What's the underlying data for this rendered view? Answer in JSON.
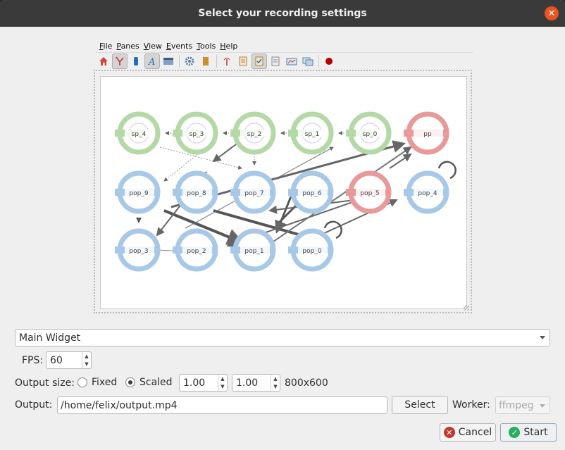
{
  "window": {
    "title": "Select your recording settings",
    "close_glyph": "✕"
  },
  "preview": {
    "menu": [
      "File",
      "Panes",
      "View",
      "Events",
      "Tools",
      "Help"
    ],
    "toolbar_icons": [
      "home-icon",
      "network-graph-icon",
      "device-icon",
      "text-icon",
      "window-icon",
      "settings-gear-icon",
      "clipboard-icon",
      "antenna-icon",
      "report-icon",
      "checked-report-icon",
      "document-icon",
      "chart-window-icon",
      "compare-window-icon",
      "record-icon"
    ],
    "graph": {
      "nodes": [
        {
          "id": "sp_4",
          "color": "green"
        },
        {
          "id": "sp_3",
          "color": "green"
        },
        {
          "id": "sp_2",
          "color": "green"
        },
        {
          "id": "sp_1",
          "color": "green"
        },
        {
          "id": "sp_0",
          "color": "green"
        },
        {
          "id": "pp",
          "color": "red"
        },
        {
          "id": "pop_9",
          "color": "blue"
        },
        {
          "id": "pop_8",
          "color": "blue"
        },
        {
          "id": "pop_7",
          "color": "blue"
        },
        {
          "id": "pop_6",
          "color": "blue"
        },
        {
          "id": "pop_5",
          "color": "red"
        },
        {
          "id": "pop_4",
          "color": "blue"
        },
        {
          "id": "pop_3",
          "color": "blue"
        },
        {
          "id": "pop_2",
          "color": "blue"
        },
        {
          "id": "pop_1",
          "color": "blue"
        },
        {
          "id": "pop_0",
          "color": "blue"
        }
      ],
      "colors": {
        "green": "#b5d9a6",
        "red": "#e89a9a",
        "blue": "#a8c8e8"
      }
    }
  },
  "settings": {
    "widget_select": "Main Widget",
    "fps_label": "FPS:",
    "fps_value": "60",
    "output_size_label": "Output size:",
    "fixed_label": "Fixed",
    "scaled_label": "Scaled",
    "scale_x": "1.00",
    "scale_y": "1.00",
    "size_text": "800x600",
    "output_label": "Output:",
    "output_path": "/home/felix/output.mp4",
    "select_button": "Select",
    "worker_label": "Worker:",
    "worker_value": "ffmpeg"
  },
  "buttons": {
    "cancel": "Cancel",
    "start": "Start"
  },
  "colors": {
    "accent": "#e95420",
    "titlebar": "#3a3a3a",
    "cancel_icon": "#c0392b",
    "start_icon": "#27ae60"
  }
}
